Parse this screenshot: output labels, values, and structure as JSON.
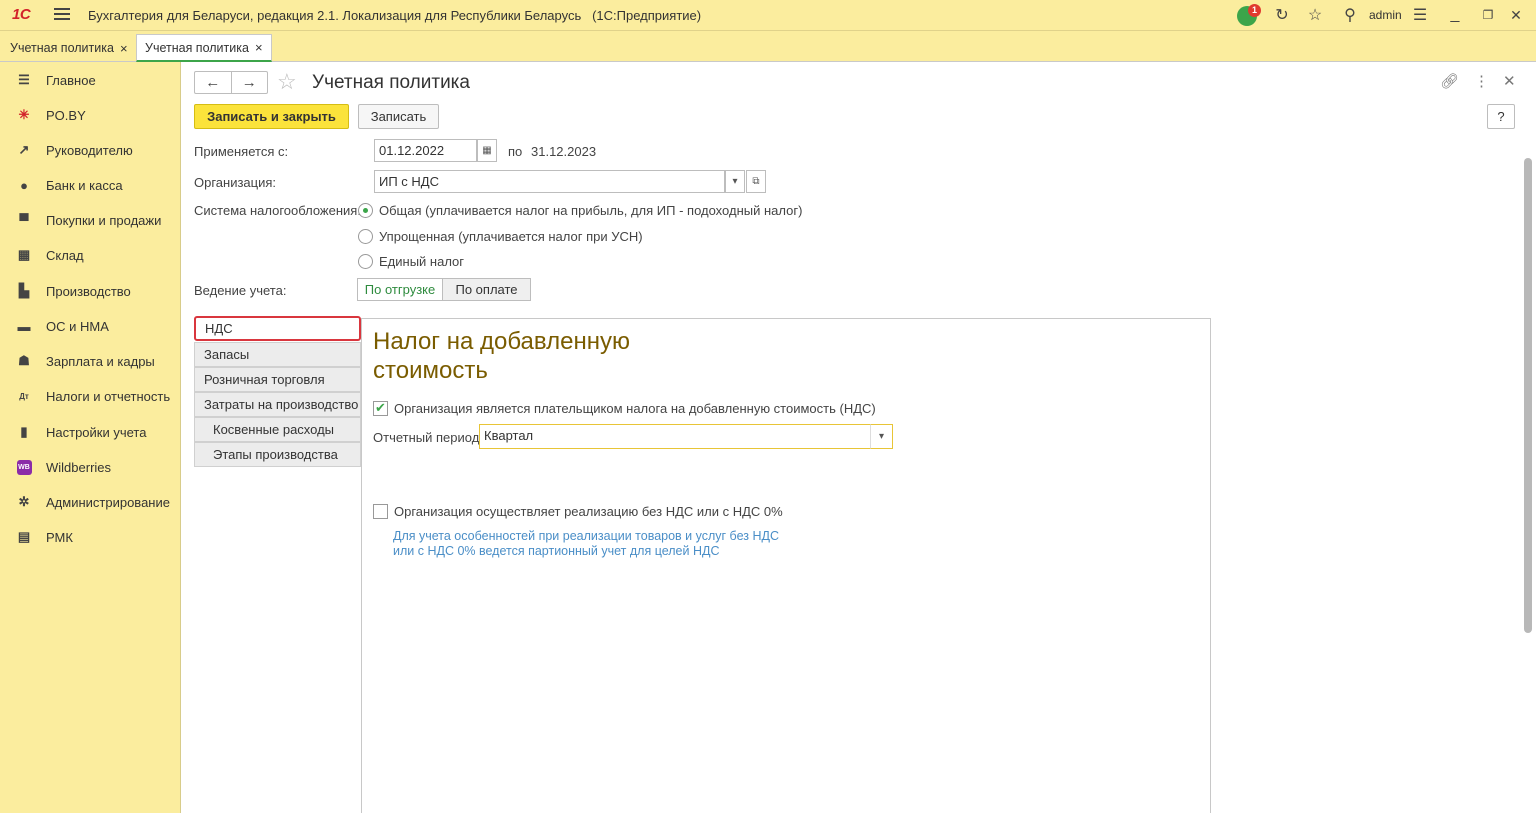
{
  "app": {
    "logo": "1С",
    "title": "Бухгалтерия для Беларуси, редакция 2.1. Локализация для Республики Беларусь",
    "platform": "(1С:Предприятие)",
    "notification_count": "1",
    "user": "admin"
  },
  "tabs": [
    {
      "label": "Учетная политика",
      "close": "×"
    },
    {
      "label": "Учетная политика",
      "close": "×"
    }
  ],
  "sidebar": {
    "items": [
      {
        "label": "Главное",
        "icon": "menu-icon"
      },
      {
        "label": "PO.BY",
        "icon": "poby-icon"
      },
      {
        "label": "Руководителю",
        "icon": "chart-icon"
      },
      {
        "label": "Банк и касса",
        "icon": "bank-icon"
      },
      {
        "label": "Покупки и продажи",
        "icon": "cart-icon"
      },
      {
        "label": "Склад",
        "icon": "warehouse-icon"
      },
      {
        "label": "Производство",
        "icon": "factory-icon"
      },
      {
        "label": "ОС и НМА",
        "icon": "truck-icon"
      },
      {
        "label": "Зарплата и кадры",
        "icon": "person-icon"
      },
      {
        "label": "Налоги и отчетность",
        "icon": "taxes-icon"
      },
      {
        "label": "Настройки учета",
        "icon": "book-icon"
      },
      {
        "label": "Wildberries",
        "icon": "wb-icon"
      },
      {
        "label": "Администрирование",
        "icon": "gear-icon"
      },
      {
        "label": "РМК",
        "icon": "register-icon"
      }
    ]
  },
  "form": {
    "title": "Учетная политика",
    "save_close_label": "Записать и закрыть",
    "save_label": "Записать",
    "help_label": "?",
    "applies_from_label": "Применяется с:",
    "applies_from_value": "01.12.2022",
    "to_label": "по",
    "to_value": "31.12.2023",
    "org_label": "Организация:",
    "org_value": "ИП с НДС",
    "tax_system_label": "Система налогообложения:",
    "tax_options": [
      {
        "label": "Общая (уплачивается налог на прибыль, для ИП - подоходный налог)",
        "selected": true
      },
      {
        "label": "Упрощенная (уплачивается налог при УСН)",
        "selected": false
      },
      {
        "label": "Единый налог",
        "selected": false
      }
    ],
    "accounting_label": "Ведение учета:",
    "accounting_options": [
      "По отгрузке",
      "По оплате"
    ],
    "accounting_selected": "По отгрузке"
  },
  "sections": [
    "НДС",
    "Запасы",
    "Розничная торговля",
    "Затраты на производство",
    "Косвенные расходы",
    "Этапы производства"
  ],
  "selected_section": "НДС",
  "vat": {
    "title": "Налог на добавленную стоимость",
    "payer_label": "Организация является плательщиком налога на добавленную стоимость (НДС)",
    "payer_checked": true,
    "period_label": "Отчетный период:",
    "period_value": "Квартал",
    "zero_label": "Организация осуществляет реализацию без НДС или с НДС 0%",
    "zero_checked": false,
    "hint": "Для учета особенностей при реализации товаров и услуг без НДС или с НДС 0% ведется партионный учет для целей НДС"
  },
  "colors": {
    "accent_yellow": "#fbed9e",
    "primary_button": "#fbe33b",
    "green": "#3ca54a",
    "section_title": "#7a5c00",
    "hint": "#4a8ec7",
    "selected_border": "#d9363e"
  }
}
